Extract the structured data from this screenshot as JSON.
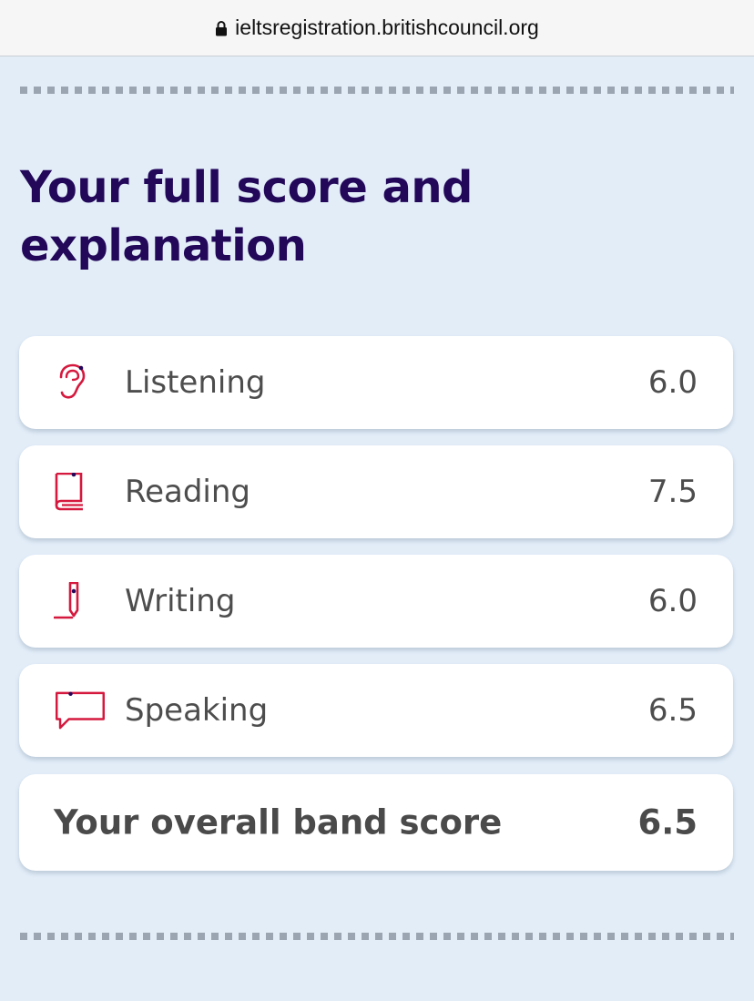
{
  "browser": {
    "url": "ieltsregistration.britishcouncil.org"
  },
  "page": {
    "title": "Your full score and explanation"
  },
  "scores": [
    {
      "label": "Listening",
      "score": "6.0",
      "icon": "ear-icon"
    },
    {
      "label": "Reading",
      "score": "7.5",
      "icon": "book-icon"
    },
    {
      "label": "Writing",
      "score": "6.0",
      "icon": "pen-icon"
    },
    {
      "label": "Speaking",
      "score": "6.5",
      "icon": "speech-bubble-icon"
    }
  ],
  "overall": {
    "label": "Your overall band score",
    "score": "6.5"
  },
  "colors": {
    "accent": "#d5193e",
    "title": "#23085a",
    "background": "#e2edf8",
    "icon_dot": "#23085a"
  }
}
